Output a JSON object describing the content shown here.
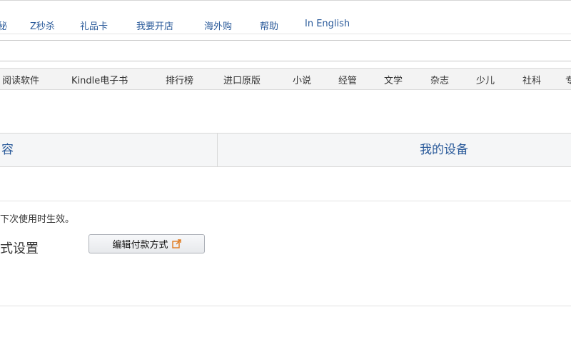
{
  "top_nav": {
    "items": [
      "秘",
      "Z秒杀",
      "礼品卡",
      "我要开店",
      "海外购",
      "帮助",
      "In English"
    ]
  },
  "categories": {
    "items": [
      "阅读软件",
      "Kindle电子书",
      "排行榜",
      "进口原版",
      "小说",
      "经管",
      "文学",
      "杂志",
      "少儿",
      "社科",
      "专"
    ]
  },
  "tabs": {
    "content_label": "容",
    "devices_label": "我的设备"
  },
  "settings": {
    "notice": "下次使用时生效。",
    "section_title": "式设置",
    "edit_button_label": "编辑付款方式",
    "edit_button_icon": "external-link-icon"
  },
  "colors": {
    "link": "#2a5a9a",
    "external_icon": "#e07a1e"
  }
}
